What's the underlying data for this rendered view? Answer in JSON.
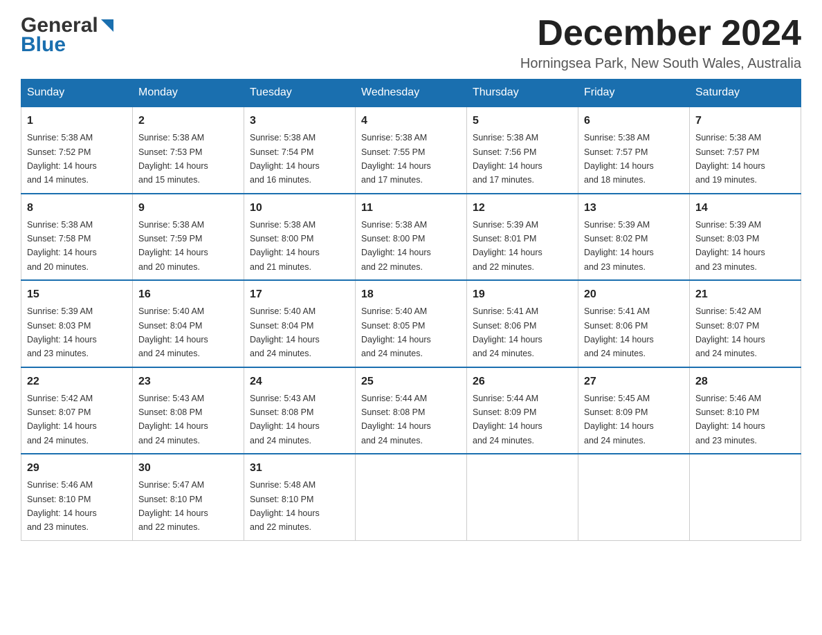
{
  "header": {
    "logo_general": "General",
    "logo_blue": "Blue",
    "month_title": "December 2024",
    "subtitle": "Horningsea Park, New South Wales, Australia"
  },
  "weekdays": [
    "Sunday",
    "Monday",
    "Tuesday",
    "Wednesday",
    "Thursday",
    "Friday",
    "Saturday"
  ],
  "weeks": [
    [
      {
        "day": "1",
        "sunrise": "5:38 AM",
        "sunset": "7:52 PM",
        "daylight": "14 hours and 14 minutes."
      },
      {
        "day": "2",
        "sunrise": "5:38 AM",
        "sunset": "7:53 PM",
        "daylight": "14 hours and 15 minutes."
      },
      {
        "day": "3",
        "sunrise": "5:38 AM",
        "sunset": "7:54 PM",
        "daylight": "14 hours and 16 minutes."
      },
      {
        "day": "4",
        "sunrise": "5:38 AM",
        "sunset": "7:55 PM",
        "daylight": "14 hours and 17 minutes."
      },
      {
        "day": "5",
        "sunrise": "5:38 AM",
        "sunset": "7:56 PM",
        "daylight": "14 hours and 17 minutes."
      },
      {
        "day": "6",
        "sunrise": "5:38 AM",
        "sunset": "7:57 PM",
        "daylight": "14 hours and 18 minutes."
      },
      {
        "day": "7",
        "sunrise": "5:38 AM",
        "sunset": "7:57 PM",
        "daylight": "14 hours and 19 minutes."
      }
    ],
    [
      {
        "day": "8",
        "sunrise": "5:38 AM",
        "sunset": "7:58 PM",
        "daylight": "14 hours and 20 minutes."
      },
      {
        "day": "9",
        "sunrise": "5:38 AM",
        "sunset": "7:59 PM",
        "daylight": "14 hours and 20 minutes."
      },
      {
        "day": "10",
        "sunrise": "5:38 AM",
        "sunset": "8:00 PM",
        "daylight": "14 hours and 21 minutes."
      },
      {
        "day": "11",
        "sunrise": "5:38 AM",
        "sunset": "8:00 PM",
        "daylight": "14 hours and 22 minutes."
      },
      {
        "day": "12",
        "sunrise": "5:39 AM",
        "sunset": "8:01 PM",
        "daylight": "14 hours and 22 minutes."
      },
      {
        "day": "13",
        "sunrise": "5:39 AM",
        "sunset": "8:02 PM",
        "daylight": "14 hours and 23 minutes."
      },
      {
        "day": "14",
        "sunrise": "5:39 AM",
        "sunset": "8:03 PM",
        "daylight": "14 hours and 23 minutes."
      }
    ],
    [
      {
        "day": "15",
        "sunrise": "5:39 AM",
        "sunset": "8:03 PM",
        "daylight": "14 hours and 23 minutes."
      },
      {
        "day": "16",
        "sunrise": "5:40 AM",
        "sunset": "8:04 PM",
        "daylight": "14 hours and 24 minutes."
      },
      {
        "day": "17",
        "sunrise": "5:40 AM",
        "sunset": "8:04 PM",
        "daylight": "14 hours and 24 minutes."
      },
      {
        "day": "18",
        "sunrise": "5:40 AM",
        "sunset": "8:05 PM",
        "daylight": "14 hours and 24 minutes."
      },
      {
        "day": "19",
        "sunrise": "5:41 AM",
        "sunset": "8:06 PM",
        "daylight": "14 hours and 24 minutes."
      },
      {
        "day": "20",
        "sunrise": "5:41 AM",
        "sunset": "8:06 PM",
        "daylight": "14 hours and 24 minutes."
      },
      {
        "day": "21",
        "sunrise": "5:42 AM",
        "sunset": "8:07 PM",
        "daylight": "14 hours and 24 minutes."
      }
    ],
    [
      {
        "day": "22",
        "sunrise": "5:42 AM",
        "sunset": "8:07 PM",
        "daylight": "14 hours and 24 minutes."
      },
      {
        "day": "23",
        "sunrise": "5:43 AM",
        "sunset": "8:08 PM",
        "daylight": "14 hours and 24 minutes."
      },
      {
        "day": "24",
        "sunrise": "5:43 AM",
        "sunset": "8:08 PM",
        "daylight": "14 hours and 24 minutes."
      },
      {
        "day": "25",
        "sunrise": "5:44 AM",
        "sunset": "8:08 PM",
        "daylight": "14 hours and 24 minutes."
      },
      {
        "day": "26",
        "sunrise": "5:44 AM",
        "sunset": "8:09 PM",
        "daylight": "14 hours and 24 minutes."
      },
      {
        "day": "27",
        "sunrise": "5:45 AM",
        "sunset": "8:09 PM",
        "daylight": "14 hours and 24 minutes."
      },
      {
        "day": "28",
        "sunrise": "5:46 AM",
        "sunset": "8:10 PM",
        "daylight": "14 hours and 23 minutes."
      }
    ],
    [
      {
        "day": "29",
        "sunrise": "5:46 AM",
        "sunset": "8:10 PM",
        "daylight": "14 hours and 23 minutes."
      },
      {
        "day": "30",
        "sunrise": "5:47 AM",
        "sunset": "8:10 PM",
        "daylight": "14 hours and 22 minutes."
      },
      {
        "day": "31",
        "sunrise": "5:48 AM",
        "sunset": "8:10 PM",
        "daylight": "14 hours and 22 minutes."
      },
      null,
      null,
      null,
      null
    ]
  ],
  "labels": {
    "sunrise": "Sunrise:",
    "sunset": "Sunset:",
    "daylight": "Daylight:"
  }
}
